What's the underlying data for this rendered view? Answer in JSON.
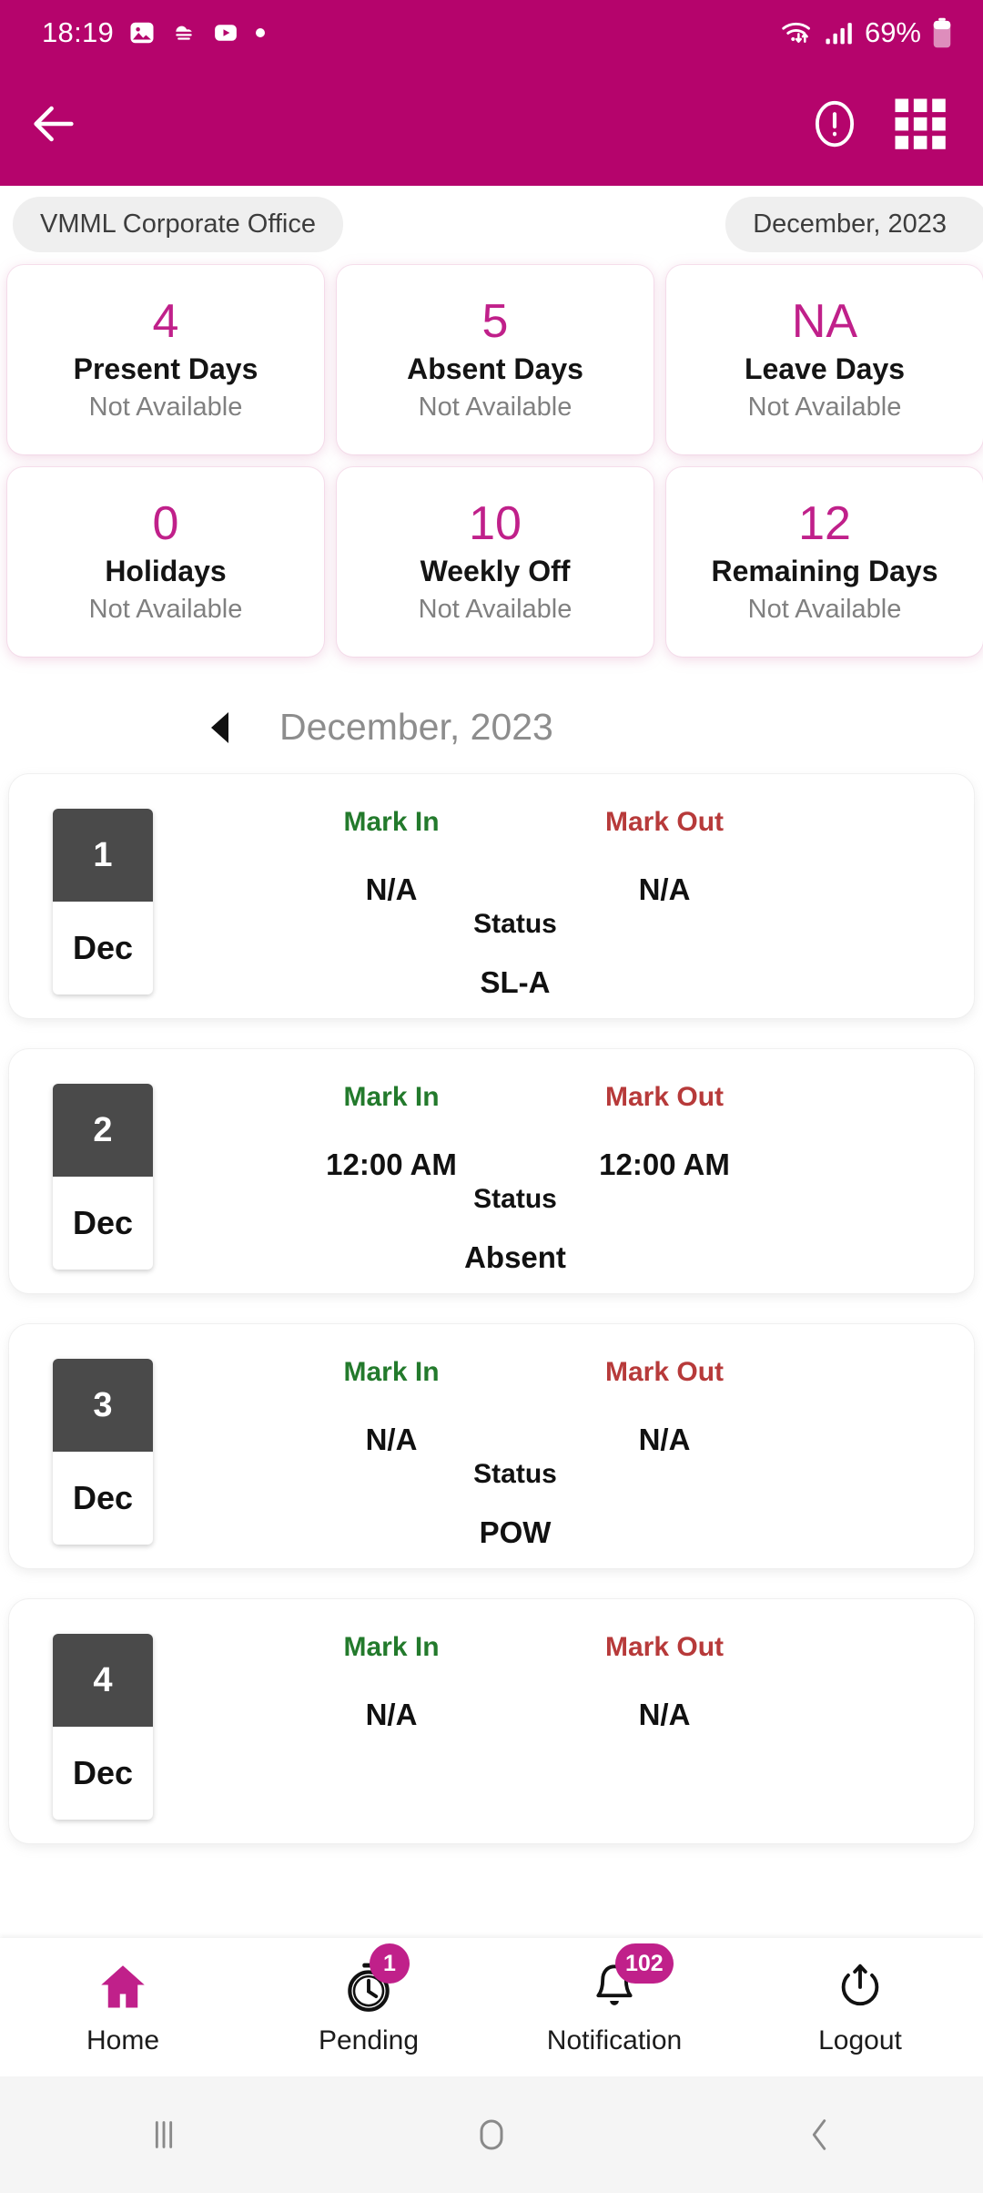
{
  "status_bar": {
    "time": "18:19",
    "battery_percent": "69%",
    "left_icons": [
      "image-icon",
      "weather-cloud-icon",
      "youtube-icon",
      "dot-icon"
    ],
    "right_icons": [
      "wifi-icon",
      "signal-bars-icon",
      "battery-icon"
    ]
  },
  "app_bar": {
    "back_icon": "back-arrow-icon",
    "info_icon": "info-circle-icon",
    "apps_icon": "apps-grid-icon"
  },
  "chips": {
    "office": "VMML Corporate Office",
    "period": "December, 2023"
  },
  "colors": {
    "brand": "#b5046c",
    "accent": "#c0208a",
    "mark_in": "#237a2c",
    "mark_out": "#b73a3a",
    "badge": "#c0208a"
  },
  "summary_cards": [
    {
      "value": "4",
      "label": "Present Days",
      "sub": "Not Available"
    },
    {
      "value": "5",
      "label": "Absent Days",
      "sub": "Not Available"
    },
    {
      "value": "NA",
      "label": "Leave Days",
      "sub": "Not Available"
    },
    {
      "value": "0",
      "label": "Holidays",
      "sub": "Not Available"
    },
    {
      "value": "10",
      "label": "Weekly Off",
      "sub": "Not Available"
    },
    {
      "value": "12",
      "label": "Remaining Days",
      "sub": "Not Available"
    }
  ],
  "month_nav": {
    "prev_icon": "prev-arrow-icon",
    "title": "December, 2023"
  },
  "attendance": {
    "headers": {
      "mark_in": "Mark In",
      "mark_out": "Mark Out",
      "status": "Status"
    },
    "rows": [
      {
        "day": "1",
        "month": "Dec",
        "mark_in": "N/A",
        "mark_out": "N/A",
        "status": "SL-A"
      },
      {
        "day": "2",
        "month": "Dec",
        "mark_in": "12:00 AM",
        "mark_out": "12:00 AM",
        "status": "Absent"
      },
      {
        "day": "3",
        "month": "Dec",
        "mark_in": "N/A",
        "mark_out": "N/A",
        "status": "POW"
      },
      {
        "day": "4",
        "month": "Dec",
        "mark_in": "N/A",
        "mark_out": "N/A",
        "status": ""
      }
    ]
  },
  "bottom_nav": [
    {
      "label": "Home",
      "icon": "home-icon",
      "badge": ""
    },
    {
      "label": "Pending",
      "icon": "stopwatch-icon",
      "badge": "1"
    },
    {
      "label": "Notification",
      "icon": "bell-icon",
      "badge": "102"
    },
    {
      "label": "Logout",
      "icon": "power-icon",
      "badge": ""
    }
  ],
  "system_nav": {
    "recents": "recents-icon",
    "home": "home-square-icon",
    "back": "back-chevron-icon"
  }
}
